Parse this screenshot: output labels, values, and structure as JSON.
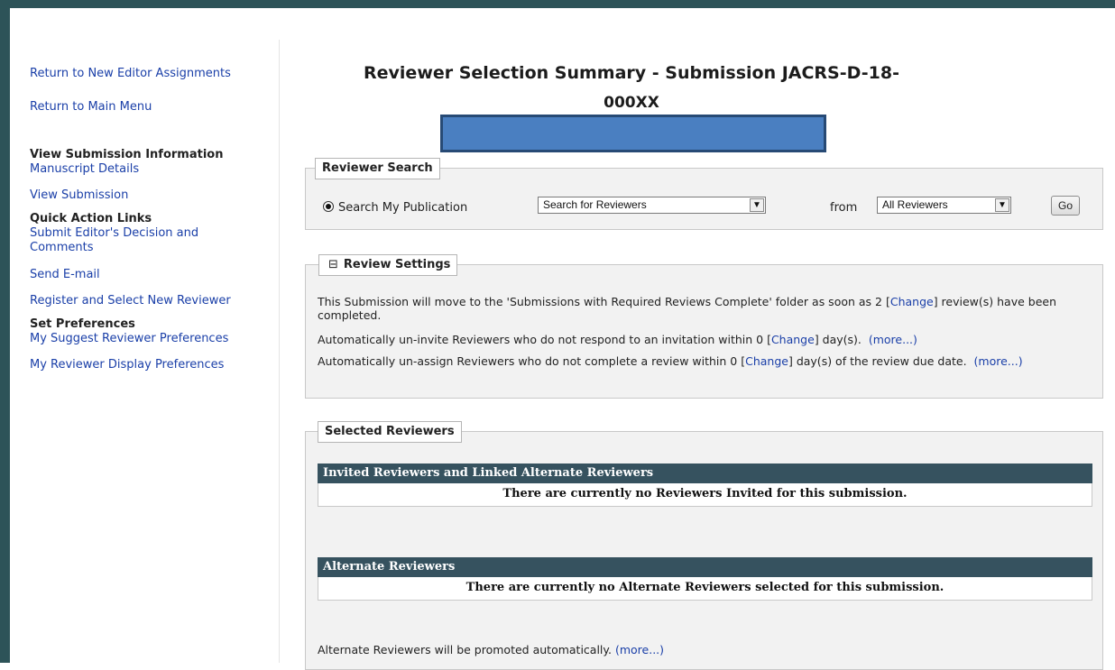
{
  "sidebar": {
    "links_top": [
      "Return to New Editor Assignments",
      "Return to Main Menu"
    ],
    "view_submission_title": "View Submission Information",
    "view_submission_links": [
      "Manuscript Details",
      "View Submission"
    ],
    "quick_action_title": "Quick Action Links",
    "quick_action_links": [
      "Submit Editor's Decision and Comments",
      "Send E-mail",
      "Register and Select New Reviewer"
    ],
    "preferences_title": "Set Preferences",
    "preferences_links": [
      "My Suggest Reviewer Preferences",
      "My Reviewer Display Preferences"
    ]
  },
  "page": {
    "title_line1": "Reviewer Selection Summary - Submission JACRS-D-18-",
    "title_line2": "000XX"
  },
  "reviewer_search": {
    "legend": "Reviewer Search",
    "radio_label": "Search My Publication",
    "search_select_value": "Search for Reviewers",
    "from_label": "from",
    "from_select_value": "All Reviewers",
    "go_label": "Go"
  },
  "review_settings": {
    "legend": "Review Settings",
    "collapse_glyph": "⊟",
    "line1_text": "This Submission will move to the 'Submissions with Required Reviews Complete' folder as soon as 2 [",
    "line1_link": "Change",
    "line1_rest": "] review(s) have been completed.",
    "line2_text": "Automatically un-invite Reviewers who do not respond to an invitation within 0 [",
    "line2_link": "Change",
    "line2_rest": "] day(s).",
    "line2_more": "(more...)",
    "line3_text": "Automatically un-assign Reviewers who do not complete a review within 0 [",
    "line3_link": "Change",
    "line3_rest": "] day(s) of the review due date.",
    "line3_more": "(more...)"
  },
  "selected_reviewers": {
    "legend": "Selected Reviewers",
    "invited_header": "Invited Reviewers and Linked Alternate Reviewers",
    "invited_empty": "There are currently no Reviewers Invited for this submission.",
    "alternate_header": "Alternate Reviewers",
    "alternate_empty": "There are currently no Alternate Reviewers selected for this submission.",
    "promote_text": "Alternate Reviewers will be promoted automatically.",
    "promote_more": "(more...)"
  },
  "colors": {
    "frame": "#2d5358",
    "link": "#1a3fa8",
    "table_header": "#36525f",
    "redaction": "#4a7fc1"
  }
}
